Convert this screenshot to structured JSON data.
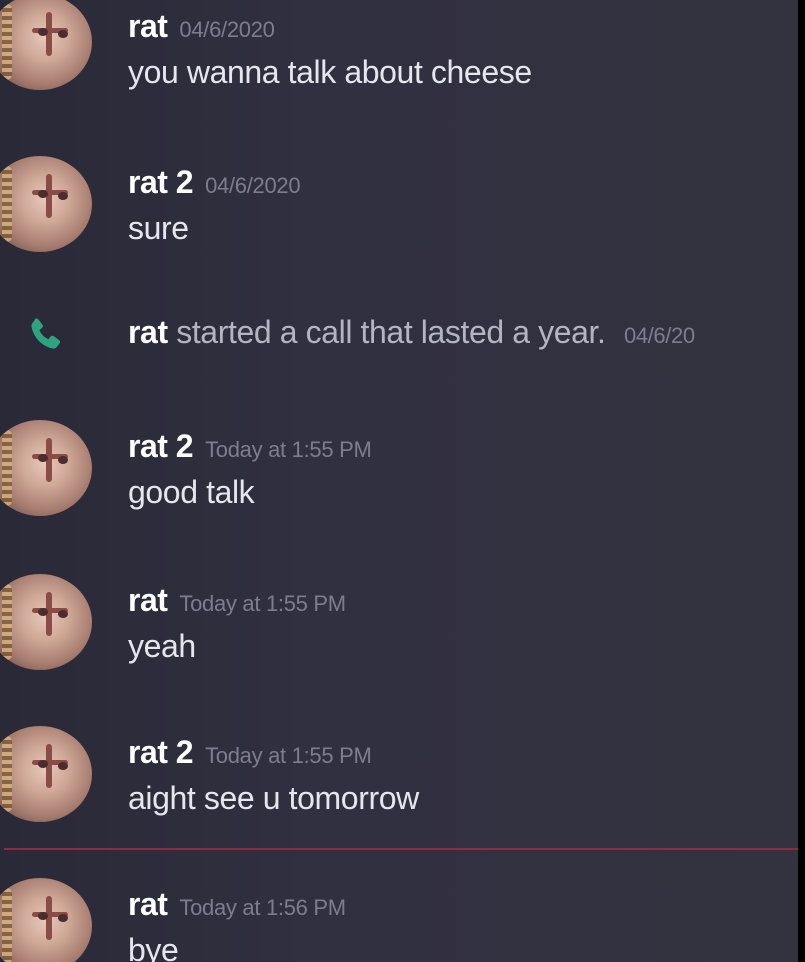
{
  "messages": [
    {
      "author": "rat",
      "time": "04/6/2020",
      "text": "you wanna talk about cheese"
    },
    {
      "author": "rat 2",
      "time": "04/6/2020",
      "text": "sure"
    },
    {
      "author": "rat 2",
      "time": "Today at 1:55 PM",
      "text": "good talk"
    },
    {
      "author": "rat",
      "time": "Today at 1:55 PM",
      "text": "yeah"
    },
    {
      "author": "rat 2",
      "time": "Today at 1:55 PM",
      "text": "aight see u tomorrow"
    },
    {
      "author": "rat",
      "time": "Today at 1:56 PM",
      "text": "bye"
    }
  ],
  "call": {
    "caller": "rat",
    "text": "started a call that lasted a year.",
    "time": "04/6/20",
    "icon": "phone-icon"
  },
  "colors": {
    "background": "#2f2e3c",
    "author": "#ffffff",
    "timestamp": "#7d7d8e",
    "call_icon": "#2fa37f",
    "divider": "#8e2b3f"
  }
}
